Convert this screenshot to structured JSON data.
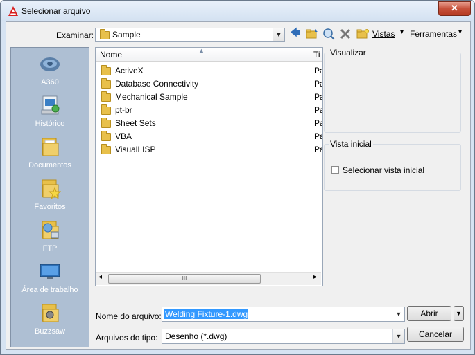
{
  "window": {
    "title": "Selecionar arquivo",
    "close_label": "✕"
  },
  "toolbar": {
    "look_in_label": "Examinar:",
    "look_in_value": "Sample",
    "views_label": "Vistas",
    "tools_label": "Ferramentas",
    "caret": "▾"
  },
  "places": [
    {
      "label": "A360",
      "icon": "a360-cloud-icon"
    },
    {
      "label": "Histórico",
      "icon": "history-icon"
    },
    {
      "label": "Documentos",
      "icon": "documents-folder-icon"
    },
    {
      "label": "Favoritos",
      "icon": "favorites-folder-icon"
    },
    {
      "label": "FTP",
      "icon": "ftp-icon"
    },
    {
      "label": "Área de trabalho",
      "icon": "desktop-icon"
    },
    {
      "label": "Buzzsaw",
      "icon": "buzzsaw-icon"
    }
  ],
  "file_list": {
    "columns": [
      "Nome",
      "Ti"
    ],
    "rows": [
      {
        "name": "ActiveX",
        "type": "Pa"
      },
      {
        "name": "Database Connectivity",
        "type": "Pa"
      },
      {
        "name": "Mechanical Sample",
        "type": "Pa"
      },
      {
        "name": "pt-br",
        "type": "Pa"
      },
      {
        "name": "Sheet Sets",
        "type": "Pa"
      },
      {
        "name": "VBA",
        "type": "Pa"
      },
      {
        "name": "VisualLISP",
        "type": "Pa"
      }
    ],
    "scroll_thumb": "III",
    "scroll_left": "◂",
    "scroll_right": "▸"
  },
  "preview": {
    "title": "Visualizar"
  },
  "initial_view": {
    "title": "Vista inicial",
    "checkbox_label": "Selecionar vista inicial",
    "checked": false
  },
  "filename": {
    "label": "Nome do arquivo:",
    "value": "Welding Fixture-1.dwg"
  },
  "filetype": {
    "label": "Arquivos do tipo:",
    "value": "Desenho (*.dwg)"
  },
  "buttons": {
    "open": "Abrir",
    "cancel": "Cancelar"
  },
  "colors": {
    "accent": "#3399ff",
    "places_bg": "#aebfd3",
    "folder": "#e8c04a"
  }
}
